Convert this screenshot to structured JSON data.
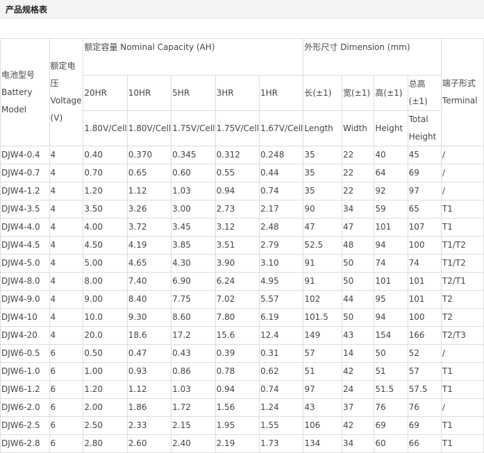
{
  "page_title": "产品规格表",
  "header": {
    "model": "电池型号 Battery Model",
    "voltage": "额定电压 Voltage (V)",
    "capacity": "额定容量 Nominal Capacity (AH)",
    "dimension": "外形尺寸 Dimension (mm)",
    "terminal": "端子形式 Terminal",
    "rates": [
      "20HR",
      "10HR",
      "5HR",
      "3HR",
      "1HR"
    ],
    "cutoffs": [
      "1.80V/Cell",
      "1.80V/Cell",
      "1.75V/Cell",
      "1.75V/Cell",
      "1.67V/Cell"
    ],
    "dim_cn": [
      "长(±1)",
      "宽(±1)",
      "高(±1)",
      "总高 (±1)"
    ],
    "dim_en": [
      "Length",
      "Width",
      "Height",
      "Total Height"
    ]
  },
  "rows": [
    [
      "DJW4-0.4",
      "4",
      "0.40",
      "0.370",
      "0.345",
      "0.312",
      "0.248",
      "35",
      "22",
      "40",
      "45",
      "/"
    ],
    [
      "DJW4-0.7",
      "4",
      "0.70",
      "0.65",
      "0.60",
      "0.55",
      "0.44",
      "35",
      "22",
      "64",
      "69",
      "/"
    ],
    [
      "DJW4-1.2",
      "4",
      "1.20",
      "1.12",
      "1.03",
      "0.94",
      "0.74",
      "35",
      "22",
      "92",
      "97",
      "/"
    ],
    [
      "DJW4-3.5",
      "4",
      "3.50",
      "3.26",
      "3.00",
      "2.73",
      "2.17",
      "90",
      "34",
      "59",
      "65",
      "T1"
    ],
    [
      "DJW4-4.0",
      "4",
      "4.00",
      "3.72",
      "3.45",
      "3.12",
      "2.48",
      "47",
      "47",
      "101",
      "107",
      "T1"
    ],
    [
      "DJW4-4.5",
      "4",
      "4.50",
      "4.19",
      "3.85",
      "3.51",
      "2.79",
      "52.5",
      "48",
      "94",
      "100",
      "T1/T2"
    ],
    [
      "DJW4-5.0",
      "4",
      "5.00",
      "4.65",
      "4.30",
      "3.90",
      "3.10",
      "91",
      "50",
      "74",
      "74",
      "T1/T2"
    ],
    [
      "DJW4-8.0",
      "4",
      "8.00",
      "7.40",
      "6.90",
      "6.24",
      "4.95",
      "91",
      "50",
      "101",
      "101",
      "T2/T1"
    ],
    [
      "DJW4-9.0",
      "4",
      "9.00",
      "8.40",
      "7.75",
      "7.02",
      "5.57",
      "102",
      "44",
      "95",
      "101",
      "T2"
    ],
    [
      "DJW4-10",
      "4",
      "10.0",
      "9.30",
      "8.60",
      "7.80",
      "6.19",
      "101.5",
      "50",
      "94",
      "100",
      "T2"
    ],
    [
      "DJW4-20",
      "4",
      "20.0",
      "18.6",
      "17.2",
      "15.6",
      "12.4",
      "149",
      "43",
      "154",
      "166",
      "T2/T3"
    ],
    [
      "DJW6-0.5",
      "6",
      "0.50",
      "0.47",
      "0.43",
      "0.39",
      "0.31",
      "57",
      "14",
      "50",
      "52",
      "/"
    ],
    [
      "DJW6-1.0",
      "6",
      "1.00",
      "0.93",
      "0.86",
      "0.78",
      "0.62",
      "51",
      "42",
      "51",
      "57",
      "T1"
    ],
    [
      "DJW6-1.2",
      "6",
      "1.20",
      "1.12",
      "1.03",
      "0.94",
      "0.74",
      "97",
      "24",
      "51.5",
      "57.5",
      "T1"
    ],
    [
      "DJW6-2.0",
      "6",
      "2.00",
      "1.86",
      "1.72",
      "1.56",
      "1.24",
      "43",
      "37",
      "76",
      "76",
      "/"
    ],
    [
      "DJW6-2.5",
      "6",
      "2.50",
      "2.33",
      "2.15",
      "1.95",
      "1.55",
      "106",
      "42",
      "69",
      "69",
      "T1"
    ],
    [
      "DJW6-2.8",
      "6",
      "2.80",
      "2.60",
      "2.40",
      "2.19",
      "1.73",
      "134",
      "34",
      "60",
      "66",
      "T1"
    ]
  ]
}
